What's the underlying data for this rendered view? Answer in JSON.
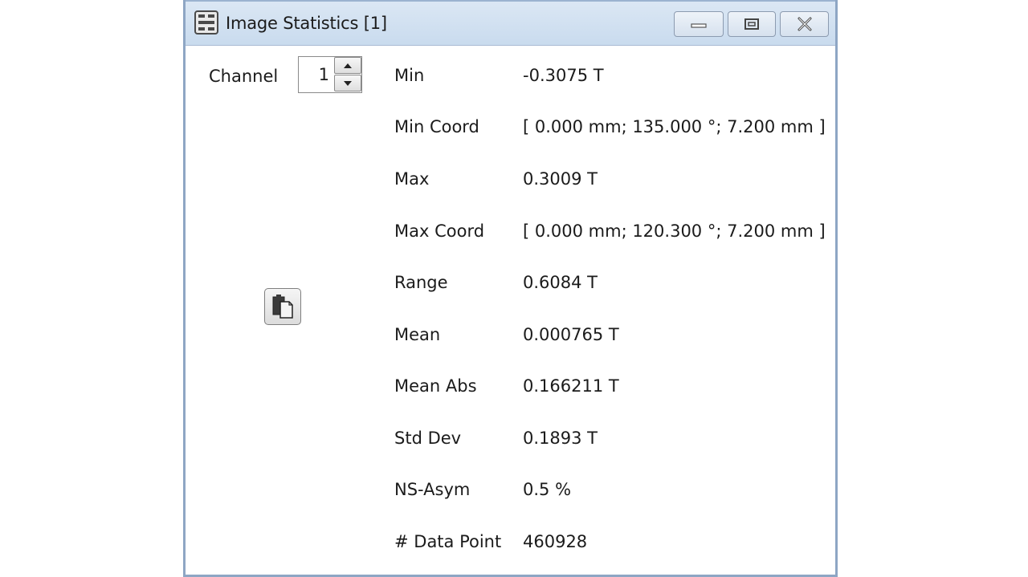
{
  "window": {
    "title": "Image Statistics [1]"
  },
  "channel": {
    "label": "Channel",
    "value": "1"
  },
  "stats": [
    {
      "label": "Min",
      "value": "-0.3075 T"
    },
    {
      "label": "Min Coord",
      "value": "[ 0.000 mm; 135.000 °; 7.200 mm ]"
    },
    {
      "label": "Max",
      "value": "0.3009 T"
    },
    {
      "label": "Max Coord",
      "value": "[ 0.000 mm; 120.300 °; 7.200 mm ]"
    },
    {
      "label": "Range",
      "value": "0.6084 T"
    },
    {
      "label": "Mean",
      "value": "0.000765 T"
    },
    {
      "label": "Mean Abs",
      "value": "0.166211 T"
    },
    {
      "label": "Std Dev",
      "value": "0.1893 T"
    },
    {
      "label": "NS-Asym",
      "value": "0.5 %"
    },
    {
      "label": "# Data Point",
      "value": "460928"
    }
  ],
  "icons": {
    "app": "app-icon",
    "minimize": "minimize-icon",
    "maximize": "maximize-icon",
    "close": "close-icon",
    "spin_up": "arrow-up-icon",
    "spin_down": "arrow-down-icon",
    "copy": "copy-icon"
  },
  "colors": {
    "frame": "#8ea6c4",
    "titlebar": "#d4e2f1",
    "text": "#1b1b1b"
  }
}
